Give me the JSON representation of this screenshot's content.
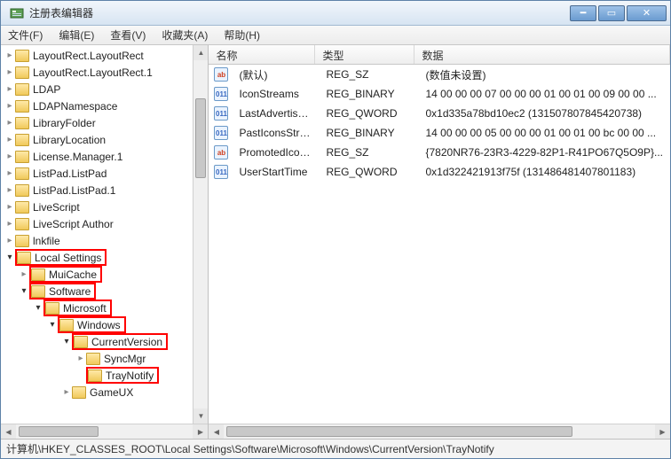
{
  "titlebar": {
    "title": "注册表编辑器"
  },
  "menu": {
    "file": "文件(F)",
    "edit": "编辑(E)",
    "view": "查看(V)",
    "fav": "收藏夹(A)",
    "help": "帮助(H)"
  },
  "tree": {
    "items": [
      {
        "indent": 0,
        "exp": "closed",
        "label": "LayoutRect.LayoutRect",
        "hl": false
      },
      {
        "indent": 0,
        "exp": "closed",
        "label": "LayoutRect.LayoutRect.1",
        "hl": false
      },
      {
        "indent": 0,
        "exp": "closed",
        "label": "LDAP",
        "hl": false
      },
      {
        "indent": 0,
        "exp": "closed",
        "label": "LDAPNamespace",
        "hl": false
      },
      {
        "indent": 0,
        "exp": "closed",
        "label": "LibraryFolder",
        "hl": false
      },
      {
        "indent": 0,
        "exp": "closed",
        "label": "LibraryLocation",
        "hl": false
      },
      {
        "indent": 0,
        "exp": "closed",
        "label": "License.Manager.1",
        "hl": false
      },
      {
        "indent": 0,
        "exp": "closed",
        "label": "ListPad.ListPad",
        "hl": false
      },
      {
        "indent": 0,
        "exp": "closed",
        "label": "ListPad.ListPad.1",
        "hl": false
      },
      {
        "indent": 0,
        "exp": "closed",
        "label": "LiveScript",
        "hl": false
      },
      {
        "indent": 0,
        "exp": "closed",
        "label": "LiveScript Author",
        "hl": false
      },
      {
        "indent": 0,
        "exp": "closed",
        "label": "lnkfile",
        "hl": false
      },
      {
        "indent": 0,
        "exp": "open",
        "label": "Local Settings",
        "hl": true
      },
      {
        "indent": 1,
        "exp": "closed",
        "label": "MuiCache",
        "hl": true
      },
      {
        "indent": 1,
        "exp": "open",
        "label": "Software",
        "hl": true
      },
      {
        "indent": 2,
        "exp": "open",
        "label": "Microsoft",
        "hl": true
      },
      {
        "indent": 3,
        "exp": "open",
        "label": "Windows",
        "hl": true
      },
      {
        "indent": 4,
        "exp": "open",
        "label": "CurrentVersion",
        "hl": true
      },
      {
        "indent": 5,
        "exp": "closed",
        "label": "SyncMgr",
        "hl": false
      },
      {
        "indent": 5,
        "exp": "none",
        "label": "TrayNotify",
        "hl": true
      },
      {
        "indent": 4,
        "exp": "closed",
        "label": "GameUX",
        "hl": false
      }
    ]
  },
  "list": {
    "cols": {
      "name": "名称",
      "type": "类型",
      "data": "数据"
    },
    "rows": [
      {
        "icon": "str",
        "name": "(默认)",
        "type": "REG_SZ",
        "data": "(数值未设置)"
      },
      {
        "icon": "bin",
        "name": "IconStreams",
        "type": "REG_BINARY",
        "data": "14 00 00 00 07 00 00 00 01 00 01 00 09 00 00 ..."
      },
      {
        "icon": "bin",
        "name": "LastAdvertise...",
        "type": "REG_QWORD",
        "data": "0x1d335a78bd10ec2 (131507807845420738)"
      },
      {
        "icon": "bin",
        "name": "PastIconsStream",
        "type": "REG_BINARY",
        "data": "14 00 00 00 05 00 00 00 01 00 01 00 bc 00 00 ..."
      },
      {
        "icon": "str",
        "name": "PromotedIcon...",
        "type": "REG_SZ",
        "data": "{7820NR76-23R3-4229-82P1-R41PO67Q5O9P}..."
      },
      {
        "icon": "bin",
        "name": "UserStartTime",
        "type": "REG_QWORD",
        "data": "0x1d322421913f75f (131486481407801183)"
      }
    ]
  },
  "statusbar": {
    "path": "计算机\\HKEY_CLASSES_ROOT\\Local Settings\\Software\\Microsoft\\Windows\\CurrentVersion\\TrayNotify"
  }
}
